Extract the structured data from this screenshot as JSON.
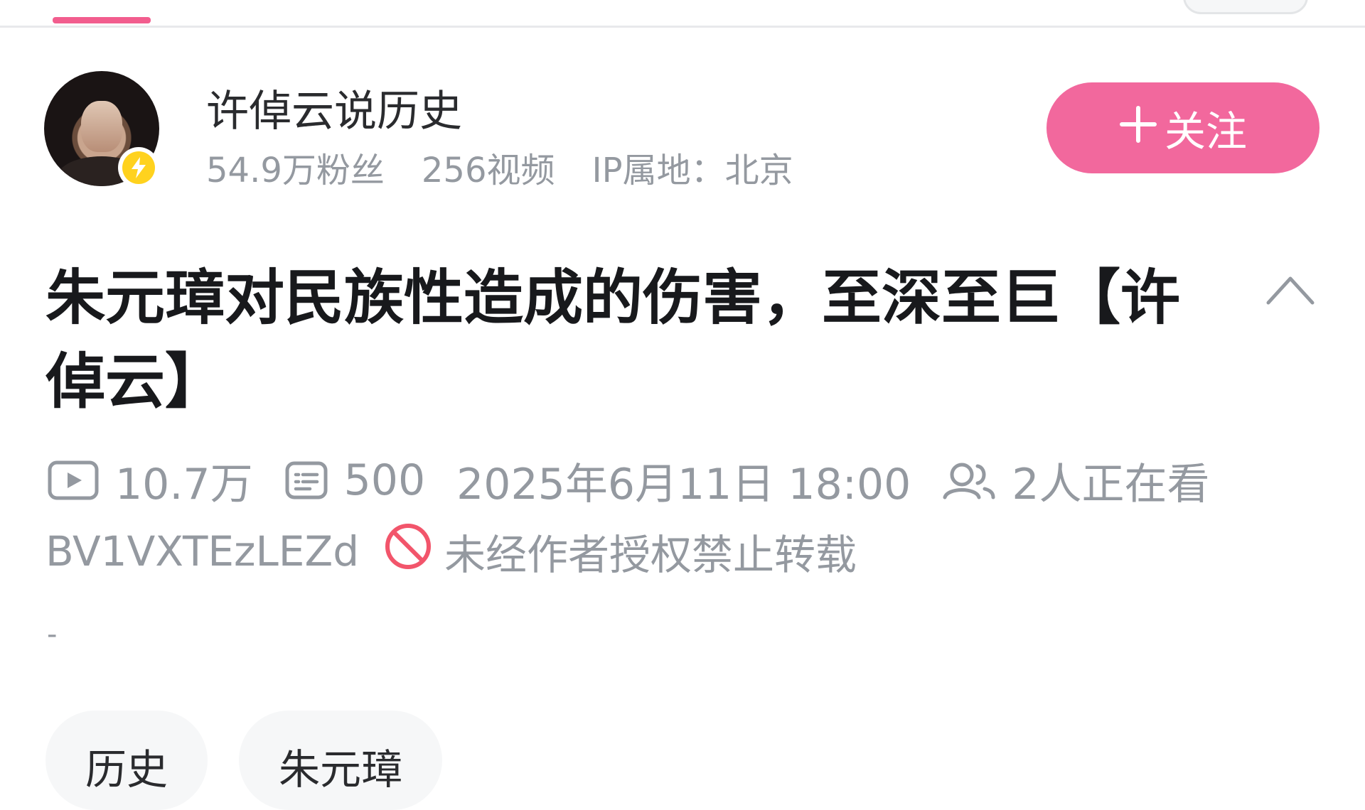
{
  "author": {
    "name": "许倬云说历史",
    "followers": "54.9万粉丝",
    "videos": "256视频",
    "ip_location": "IP属地：北京",
    "follow_label": "关注"
  },
  "video": {
    "title": "朱元璋对民族性造成的伤害，至深至巨【许倬云】",
    "views": "10.7万",
    "danmaku": "500",
    "publish_time": "2025年6月11日 18:00",
    "watching_now": "2人正在看",
    "bvid": "BV1VXTEzLEZd",
    "copyright_notice": "未经作者授权禁止转载",
    "description": "-"
  },
  "tags": [
    "历史",
    "朱元璋"
  ],
  "colors": {
    "accent": "#f2689d",
    "verified_badge": "#ffd21e",
    "muted_text": "#9499a0",
    "no_repost_red": "#f2556b"
  },
  "icons": {
    "views": "play-icon",
    "danmaku": "danmaku-icon",
    "watching": "people-icon",
    "copyright": "prohibited-icon",
    "collapse": "chevron-up-icon",
    "verified": "lightning-badge-icon"
  }
}
